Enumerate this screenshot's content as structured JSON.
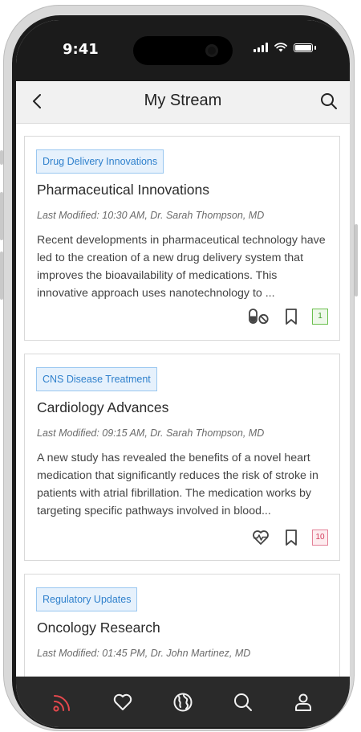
{
  "status_bar": {
    "time": "9:41"
  },
  "header": {
    "title": "My Stream"
  },
  "cards": [
    {
      "tag": "Drug Delivery Innovations",
      "title": "Pharmaceutical Innovations",
      "meta": "Last Modified: 10:30 AM, Dr. Sarah Thompson, MD",
      "body": "Recent developments in pharmaceutical technology have led to the creation of a new drug delivery system that improves the bioavailability of medications. This innovative approach uses nanotechnology to ...",
      "category_icon": "pill-no-icon",
      "count": "1",
      "count_color": "#3f9e27"
    },
    {
      "tag": "CNS Disease Treatment",
      "title": "Cardiology Advances",
      "meta": "Last Modified: 09:15 AM, Dr. Sarah Thompson, MD",
      "body": "A new study has revealed the benefits of a novel heart medication that significantly reduces the risk of stroke in patients with atrial fibrillation. The medication works by targeting specific pathways involved in blood...",
      "category_icon": "heart-pulse-icon",
      "count": "10",
      "count_color": "#d23c5b"
    },
    {
      "tag": "Regulatory Updates",
      "title": "Oncology Research",
      "meta": "Last Modified: 01:45 PM, Dr. John Martinez, MD",
      "body": ""
    }
  ],
  "bottom_nav": {
    "items": [
      {
        "icon": "stream-icon",
        "active": true
      },
      {
        "icon": "heart-icon",
        "active": false
      },
      {
        "icon": "globe-icon",
        "active": false
      },
      {
        "icon": "search-icon",
        "active": false
      },
      {
        "icon": "profile-icon",
        "active": false
      }
    ],
    "active_color": "#e5484d"
  }
}
